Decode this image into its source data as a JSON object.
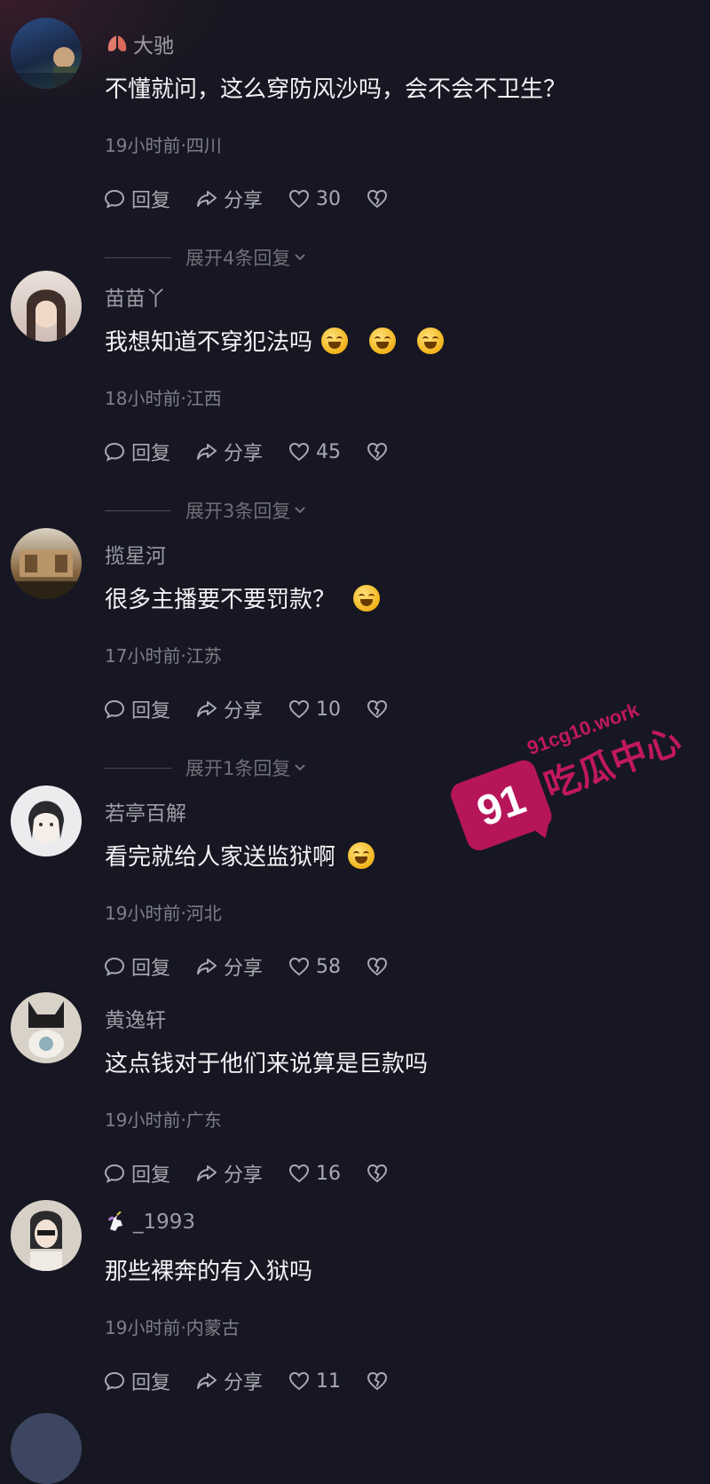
{
  "comments": [
    {
      "username": "大驰",
      "text": "不懂就问，这么穿防风沙吗，会不会不卫生？",
      "meta": "19小时前·四川",
      "reply_label": "回复",
      "share_label": "分享",
      "likes": "30",
      "expand": "展开4条回复",
      "emoji_count": 0,
      "avatar_colors": [
        "#1f3b6a",
        "#3a5f8a"
      ],
      "badge": "lungs-badge-icon"
    },
    {
      "username": "苗苗丫",
      "text": "我想知道不穿犯法吗",
      "meta": "18小时前·江西",
      "reply_label": "回复",
      "share_label": "分享",
      "likes": "45",
      "expand": "展开3条回复",
      "emoji_count": 3,
      "avatar_colors": [
        "#d8c6bf",
        "#4a3b36"
      ]
    },
    {
      "username": "揽星河",
      "text": "很多主播要不要罚款？",
      "meta": "17小时前·江苏",
      "reply_label": "回复",
      "share_label": "分享",
      "likes": "10",
      "expand": "展开1条回复",
      "emoji_count": 1,
      "avatar_colors": [
        "#8b6a44",
        "#c9b894"
      ]
    },
    {
      "username": "若亭百解",
      "text": "看完就给人家送监狱啊",
      "meta": "19小时前·河北",
      "reply_label": "回复",
      "share_label": "分享",
      "likes": "58",
      "expand": "",
      "emoji_count": 1,
      "avatar_colors": [
        "#e9e9ec",
        "#3a3a3a"
      ]
    },
    {
      "username": "黄逸轩",
      "text": "这点钱对于他们来说算是巨款吗",
      "meta": "19小时前·广东",
      "reply_label": "回复",
      "share_label": "分享",
      "likes": "16",
      "expand": "",
      "emoji_count": 0,
      "avatar_colors": [
        "#d9d4cc",
        "#2a2a2a"
      ]
    },
    {
      "username": "_1993",
      "text": "那些裸奔的有入狱吗",
      "meta": "19小时前·内蒙古",
      "reply_label": "回复",
      "share_label": "分享",
      "likes": "11",
      "expand": "",
      "emoji_count": 0,
      "avatar_colors": [
        "#cfc8c0",
        "#2b2b2b"
      ],
      "badge": "unicorn-badge-icon"
    }
  ],
  "watermark": {
    "number": "91",
    "url": "91cg10.work",
    "name": "吃瓜中心"
  },
  "colors": {
    "background": "#161722",
    "text": "#f2f2f5",
    "muted": "#7f7f89",
    "watermark": "#c0185f"
  }
}
